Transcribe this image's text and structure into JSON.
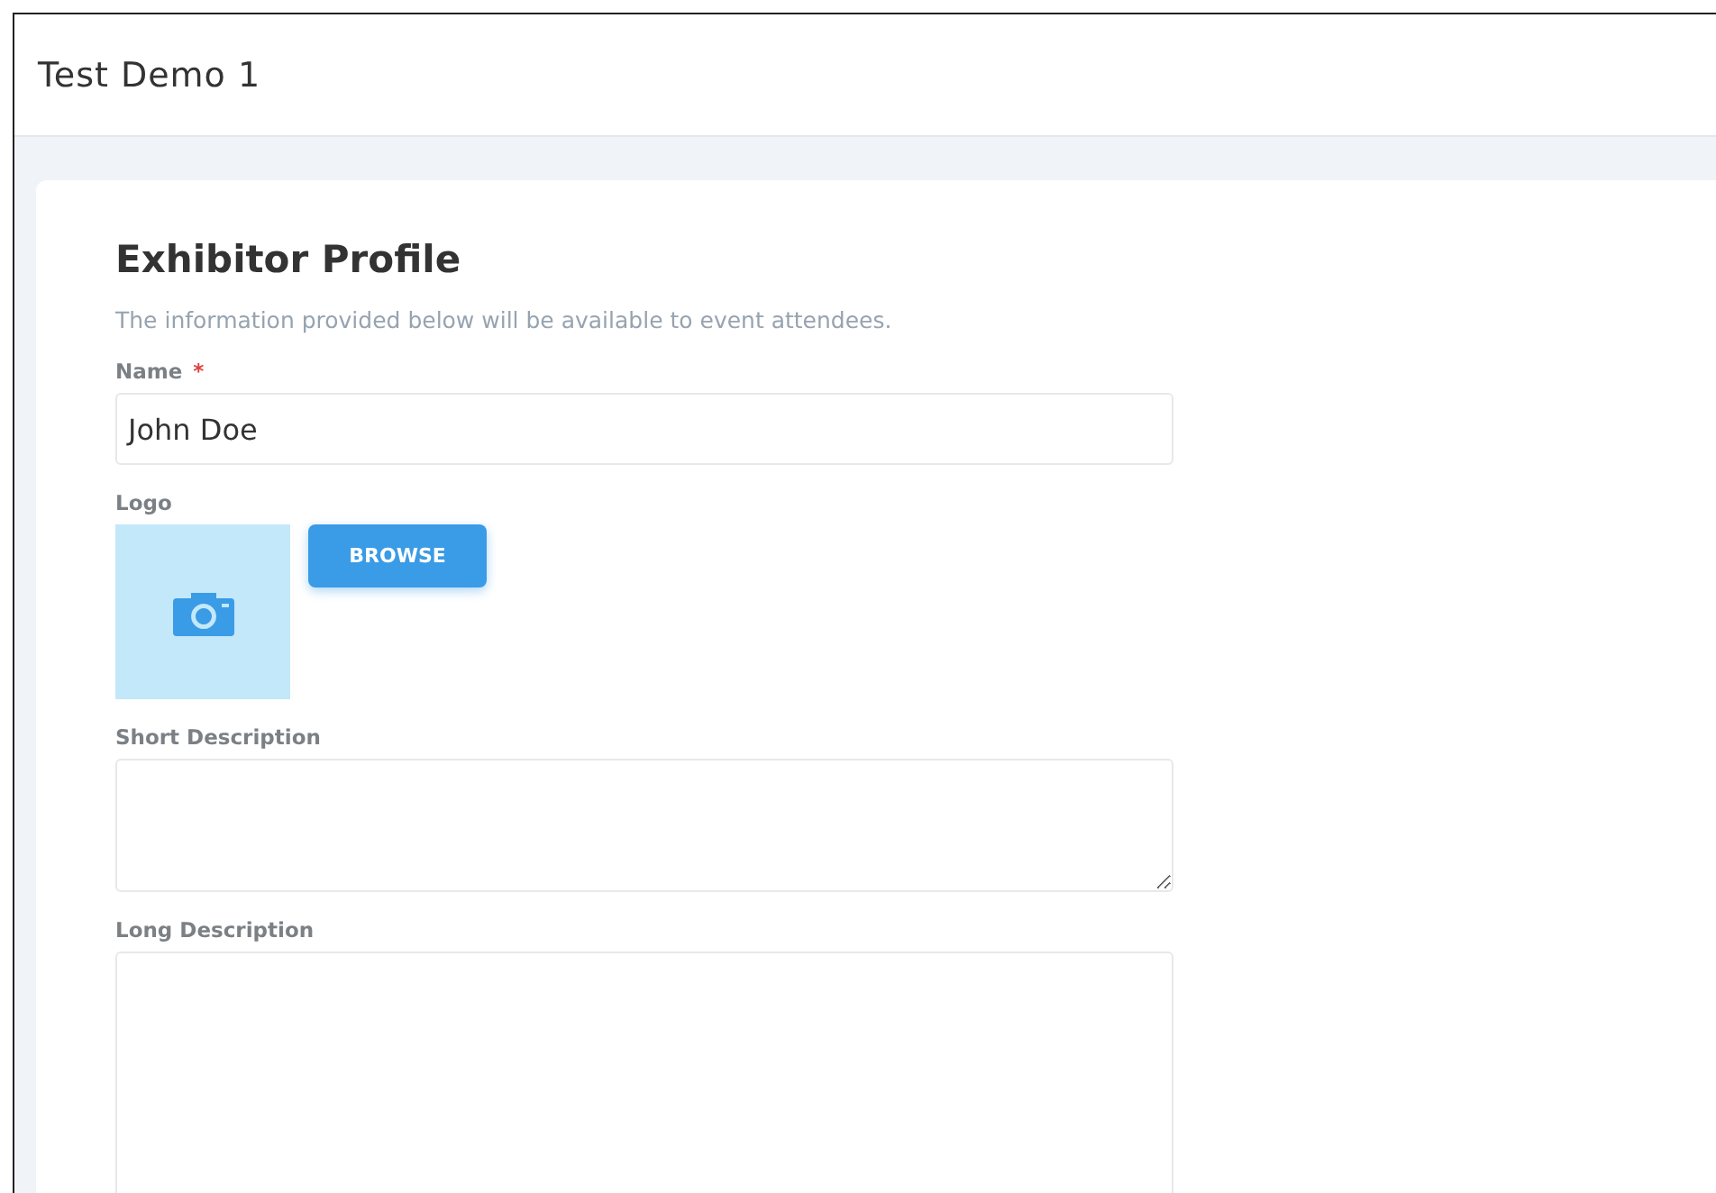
{
  "header": {
    "title": "Test Demo 1"
  },
  "form": {
    "title": "Exhibitor Profile",
    "subtitle": "The information provided below will be available to event attendees.",
    "fields": [
      {
        "kind": "text",
        "label": "Name",
        "required": true,
        "required_marker": "*",
        "value": "John Doe"
      },
      {
        "kind": "image",
        "label": "Logo",
        "required": false,
        "button": "BROWSE"
      },
      {
        "kind": "textarea",
        "label": "Short Description",
        "required": false
      },
      {
        "kind": "tallarea",
        "label": "Long Description",
        "required": false
      }
    ]
  }
}
